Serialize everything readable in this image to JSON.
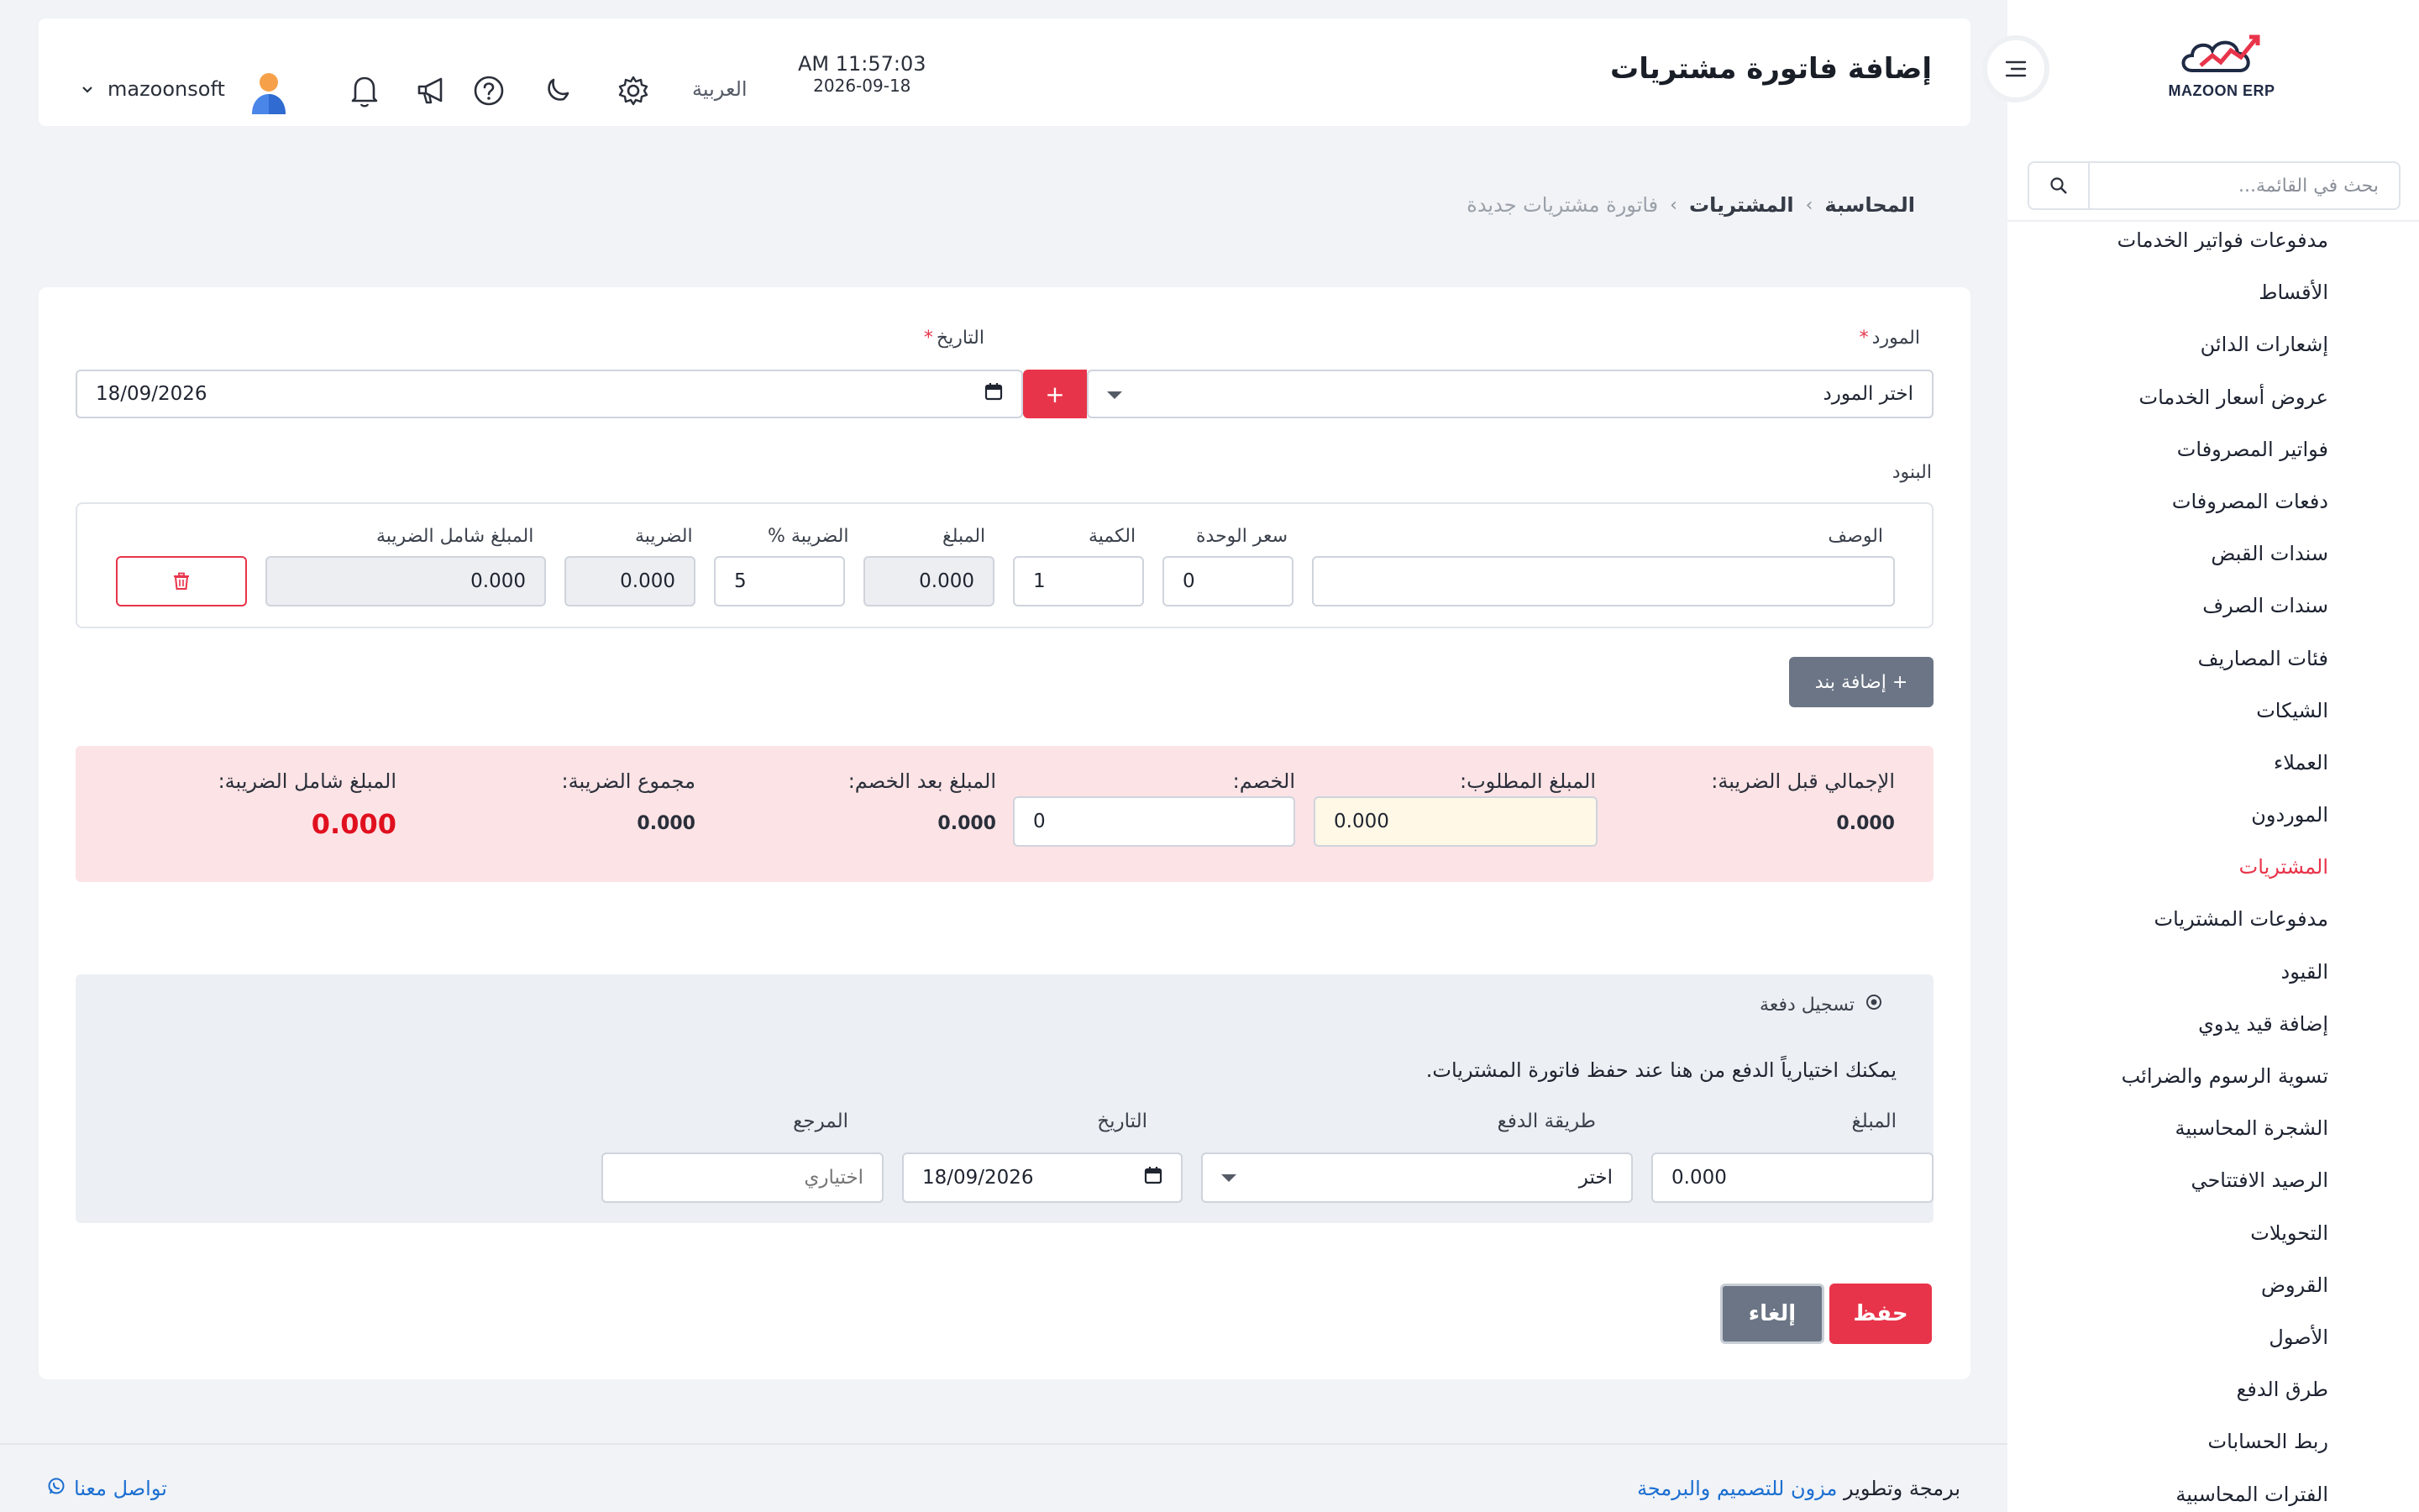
{
  "sidebar": {
    "logo_text": "MAZOON ERP",
    "search_placeholder": "بحث في القائمة...",
    "items": [
      {
        "label": "مدفوعات فواتير الخدمات"
      },
      {
        "label": "الأقساط"
      },
      {
        "label": "إشعارات الدائن"
      },
      {
        "label": "عروض أسعار الخدمات"
      },
      {
        "label": "فواتير المصروفات"
      },
      {
        "label": "دفعات المصروفات"
      },
      {
        "label": "سندات القبض"
      },
      {
        "label": "سندات الصرف"
      },
      {
        "label": "فئات المصاريف"
      },
      {
        "label": "الشيكات"
      },
      {
        "label": "العملاء"
      },
      {
        "label": "الموردون"
      },
      {
        "label": "المشتريات",
        "active": true
      },
      {
        "label": "مدفوعات المشتريات"
      },
      {
        "label": "القيود"
      },
      {
        "label": "إضافة قيد يدوي"
      },
      {
        "label": "تسوية الرسوم والضرائب"
      },
      {
        "label": "الشجرة المحاسبية"
      },
      {
        "label": "الرصيد الافتتاحي"
      },
      {
        "label": "التحويلات"
      },
      {
        "label": "القروض"
      },
      {
        "label": "الأصول"
      },
      {
        "label": "طرق الدفع"
      },
      {
        "label": "ربط الحسابات"
      },
      {
        "label": "الفترات المحاسبية"
      }
    ]
  },
  "header": {
    "title": "إضافة فاتورة مشتريات",
    "time": "AM 11:57:03",
    "date": "2026-09-18",
    "language": "العربية",
    "username": "mazoonsoft"
  },
  "breadcrumb": {
    "level1": "المحاسبة",
    "level2": "المشتريات",
    "level3": "فاتورة مشتريات جديدة"
  },
  "form": {
    "supplier_label": "المورد",
    "supplier_placeholder": "اختر المورد",
    "add_supplier_label": "+",
    "date_label": "التاريخ",
    "date_value": "18/09/2026",
    "required_mark": "*",
    "items_title": "البنود",
    "columns": {
      "description": "الوصف",
      "unit_price": "سعر الوحدة",
      "quantity": "الكمية",
      "amount": "المبلغ",
      "tax_percent": "الضريبة %",
      "tax": "الضريبة",
      "total_with_tax": "المبلغ شامل الضريبة"
    },
    "item_row": {
      "description": "",
      "unit_price": "0",
      "quantity": "1",
      "amount": "0.000",
      "tax_percent": "5",
      "tax": "0.000",
      "total_with_tax": "0.000"
    },
    "add_item_label": "+ إضافة بند"
  },
  "totals": {
    "subtotal_label": "الإجمالي قبل الضريبة:",
    "subtotal_value": "0.000",
    "required_label": "المبلغ المطلوب:",
    "required_value": "0.000",
    "discount_label": "الخصم:",
    "discount_value": "0",
    "after_discount_label": "المبلغ بعد الخصم:",
    "after_discount_value": "0.000",
    "tax_total_label": "مجموع الضريبة:",
    "tax_total_value": "0.000",
    "grand_total_label": "المبلغ شامل الضريبة:",
    "grand_total_value": "0.000",
    "grand_total_color": "#e0101e"
  },
  "payment": {
    "title": "تسجيل دفعة",
    "note": "يمكنك اختيارياً الدفع من هنا عند حفظ فاتورة المشتريات.",
    "amount_label": "المبلغ",
    "amount_value": "0.000",
    "method_label": "طريقة الدفع",
    "method_value": "اختر",
    "date_label": "التاريخ",
    "date_value": "18/09/2026",
    "reference_label": "المرجع",
    "reference_placeholder": "اختياري"
  },
  "actions": {
    "save_label": "حفظ",
    "cancel_label": "إلغاء"
  },
  "footer": {
    "credit_prefix": "برمجة وتطوير",
    "credit_link": "مزون للتصميم والبرمجة",
    "contact_label": "تواصل معنا"
  },
  "colors": {
    "accent": "#e8344a",
    "secondary_button": "#6b7585",
    "totals_bg": "#fce3e6",
    "link": "#1c6fd1"
  }
}
